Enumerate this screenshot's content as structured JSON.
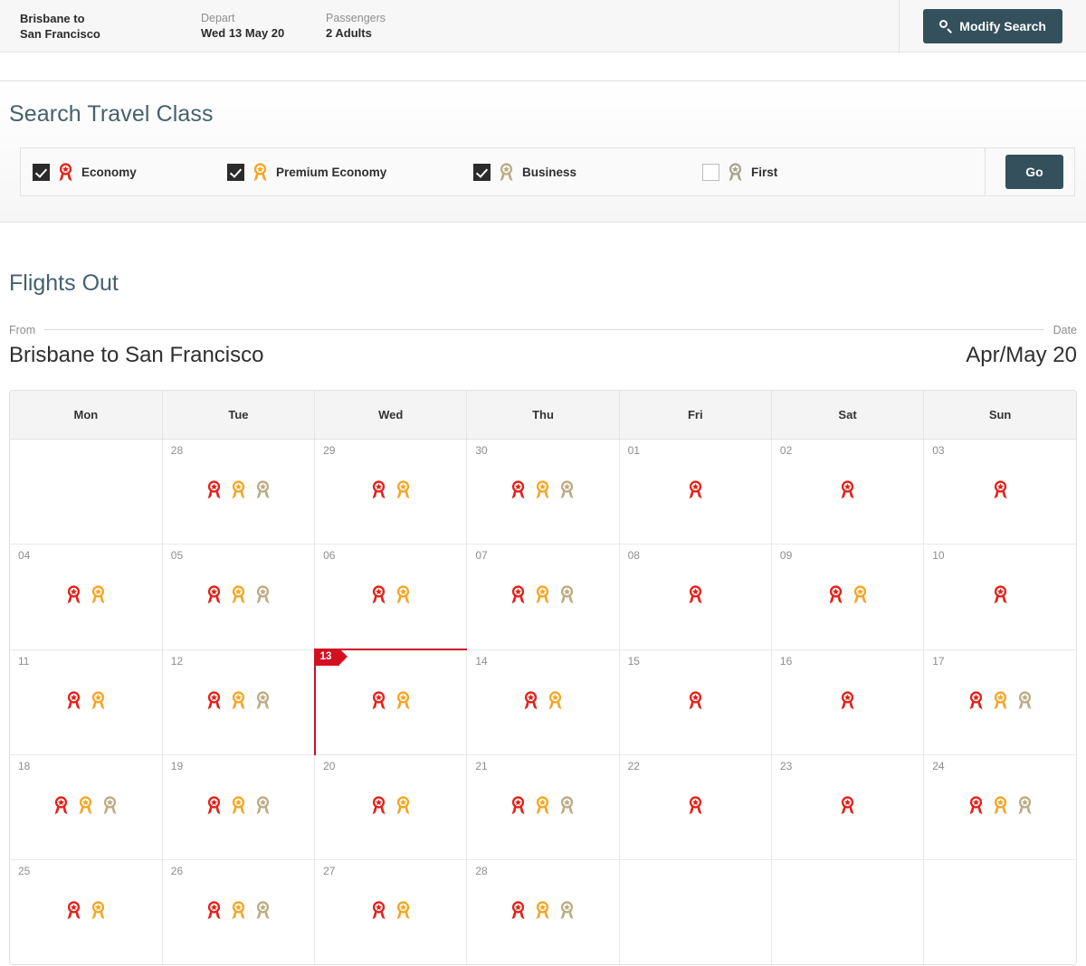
{
  "summary": {
    "route": {
      "label": "Brisbane  to",
      "value": "San Francisco"
    },
    "depart": {
      "label": "Depart",
      "value": "Wed 13 May 20"
    },
    "passengers": {
      "label": "Passengers",
      "value": "2 Adults"
    },
    "modify_button": "Modify Search"
  },
  "travel_class": {
    "title": "Search Travel Class",
    "go_label": "Go",
    "options": [
      {
        "label": "Economy",
        "checked": true,
        "color": "#e32119"
      },
      {
        "label": "Premium Economy",
        "checked": true,
        "color": "#f5a623"
      },
      {
        "label": "Business",
        "checked": true,
        "color": "#bcab84"
      },
      {
        "label": "First",
        "checked": false,
        "color": "#a9a393"
      }
    ]
  },
  "flights_out": {
    "title": "Flights Out",
    "from_caption": "From",
    "from_value": "Brisbane to San Francisco",
    "date_caption": "Date",
    "date_value": "Apr/May 20"
  },
  "calendar": {
    "weekdays": [
      "Mon",
      "Tue",
      "Wed",
      "Thu",
      "Fri",
      "Sat",
      "Sun"
    ],
    "class_colors": {
      "economy": "#e32119",
      "premium": "#f5a623",
      "business": "#bcab84",
      "first": "#a9a393"
    },
    "selected_day": "13",
    "weeks": [
      [
        {
          "day": "",
          "classes": [],
          "empty": true
        },
        {
          "day": "28",
          "classes": [
            "economy",
            "premium",
            "business"
          ]
        },
        {
          "day": "29",
          "classes": [
            "economy",
            "premium"
          ]
        },
        {
          "day": "30",
          "classes": [
            "economy",
            "premium",
            "business"
          ]
        },
        {
          "day": "01",
          "classes": [
            "economy"
          ]
        },
        {
          "day": "02",
          "classes": [
            "economy"
          ]
        },
        {
          "day": "03",
          "classes": [
            "economy"
          ]
        }
      ],
      [
        {
          "day": "04",
          "classes": [
            "economy",
            "premium"
          ]
        },
        {
          "day": "05",
          "classes": [
            "economy",
            "premium",
            "business"
          ]
        },
        {
          "day": "06",
          "classes": [
            "economy",
            "premium"
          ]
        },
        {
          "day": "07",
          "classes": [
            "economy",
            "premium",
            "business"
          ]
        },
        {
          "day": "08",
          "classes": [
            "economy"
          ]
        },
        {
          "day": "09",
          "classes": [
            "economy",
            "premium"
          ]
        },
        {
          "day": "10",
          "classes": [
            "economy"
          ]
        }
      ],
      [
        {
          "day": "11",
          "classes": [
            "economy",
            "premium"
          ]
        },
        {
          "day": "12",
          "classes": [
            "economy",
            "premium",
            "business"
          ]
        },
        {
          "day": "13",
          "classes": [
            "economy",
            "premium"
          ],
          "selected": true
        },
        {
          "day": "14",
          "classes": [
            "economy",
            "premium"
          ]
        },
        {
          "day": "15",
          "classes": [
            "economy"
          ]
        },
        {
          "day": "16",
          "classes": [
            "economy"
          ]
        },
        {
          "day": "17",
          "classes": [
            "economy",
            "premium",
            "business"
          ]
        }
      ],
      [
        {
          "day": "18",
          "classes": [
            "economy",
            "premium",
            "business"
          ]
        },
        {
          "day": "19",
          "classes": [
            "economy",
            "premium",
            "business"
          ]
        },
        {
          "day": "20",
          "classes": [
            "economy",
            "premium"
          ]
        },
        {
          "day": "21",
          "classes": [
            "economy",
            "premium",
            "business"
          ]
        },
        {
          "day": "22",
          "classes": [
            "economy"
          ]
        },
        {
          "day": "23",
          "classes": [
            "economy"
          ]
        },
        {
          "day": "24",
          "classes": [
            "economy",
            "premium",
            "business"
          ]
        }
      ],
      [
        {
          "day": "25",
          "classes": [
            "economy",
            "premium"
          ]
        },
        {
          "day": "26",
          "classes": [
            "economy",
            "premium",
            "business"
          ]
        },
        {
          "day": "27",
          "classes": [
            "economy",
            "premium"
          ]
        },
        {
          "day": "28",
          "classes": [
            "economy",
            "premium",
            "business"
          ]
        },
        {
          "day": "",
          "classes": [],
          "empty": true
        },
        {
          "day": "",
          "classes": [],
          "empty": true
        },
        {
          "day": "",
          "classes": [],
          "empty": true
        }
      ]
    ]
  }
}
